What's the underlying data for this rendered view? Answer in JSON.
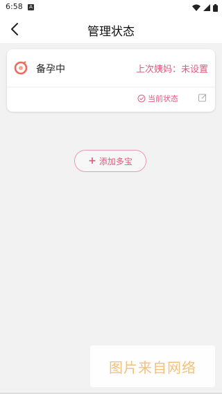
{
  "status_bar": {
    "time": "6:58",
    "notification_letter": "A"
  },
  "header": {
    "title": "管理状态"
  },
  "card": {
    "status_name": "备孕中",
    "period_info": "上次姨妈：未设置",
    "current_state_label": "当前状态"
  },
  "actions": {
    "add_label": "添加多宝"
  },
  "watermark": {
    "text": "图片来自网络"
  },
  "colors": {
    "accent": "#e0587d",
    "background": "#f2f2f2"
  }
}
